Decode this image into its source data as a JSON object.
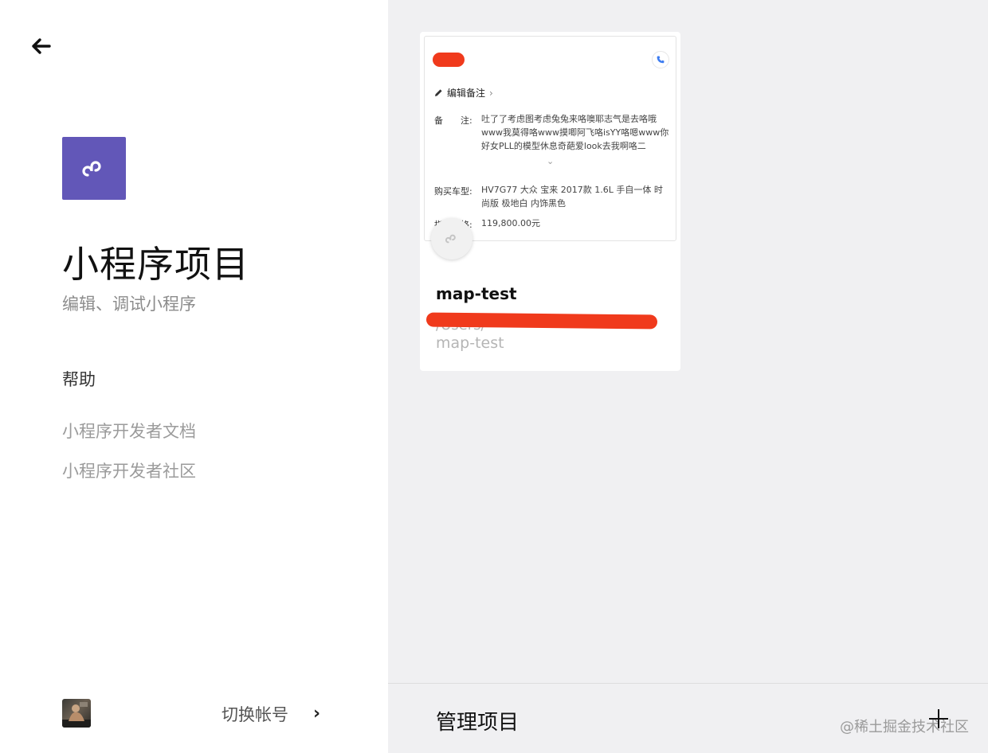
{
  "left": {
    "title": "小程序项目",
    "subtitle": "编辑、调试小程序",
    "help_heading": "帮助",
    "help_links": [
      "小程序开发者文档",
      "小程序开发者社区"
    ],
    "switch_account": "切换帐号",
    "switch_chevron": "›"
  },
  "project_card": {
    "preview": {
      "edit_note": "编辑备注",
      "edit_note_chevron": "›",
      "note_label": "备　　注:",
      "note_value": "吐了了考虑图考虑兔兔来咯噢耶志气是去咯哦www我莫得咯www摸唧阿飞咯isYY咯嗯www你好女PLL的模型休息奇葩爱look去我啊咯二",
      "expand_chevron": "⌄",
      "car_label": "购买车型:",
      "car_value": "HV7G77 大众 宝来 2017款 1.6L 手自一体 时尚版 极地白 内饰黑色",
      "price_label": "指导价格:",
      "price_value": "119,800.00元"
    },
    "name": "map-test",
    "path_partial": "/Users/",
    "path": "map-test"
  },
  "bottom": {
    "manage_projects": "管理项目",
    "watermark": "@稀土掘金技术社区"
  },
  "colors": {
    "brand": "#6257b8",
    "redaction": "#f03a1c",
    "right_bg": "#f0f0f2"
  }
}
